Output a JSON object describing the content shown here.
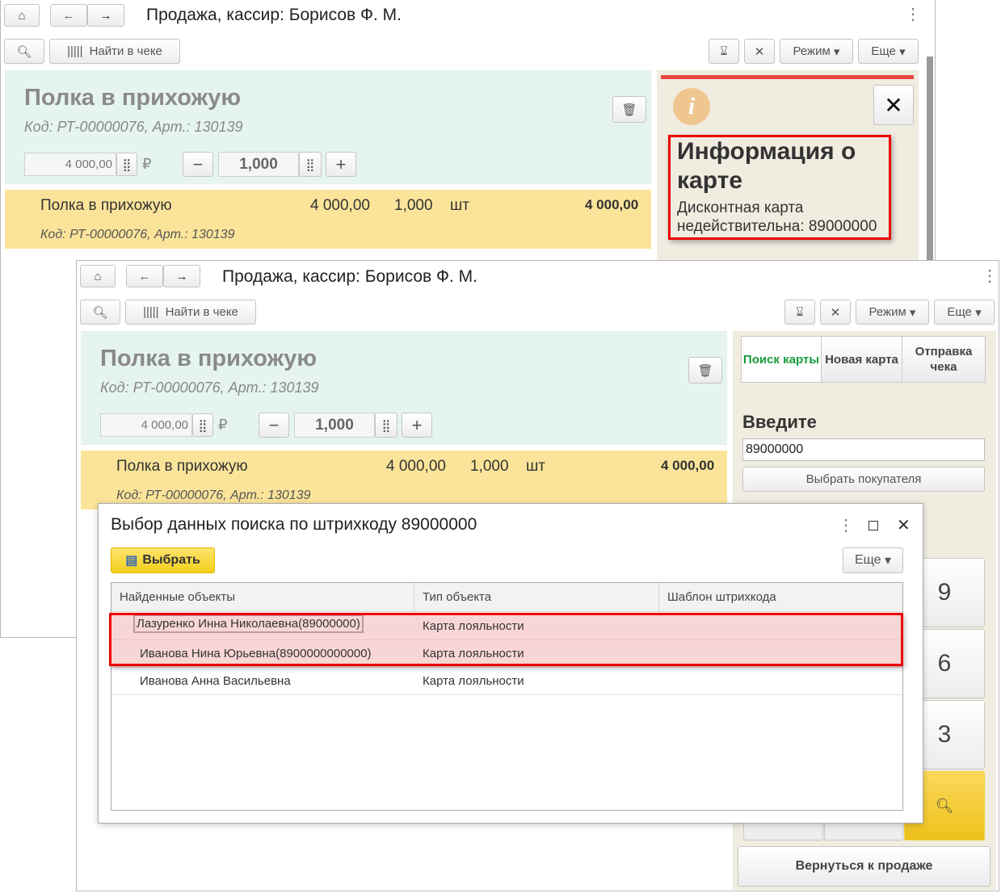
{
  "window": {
    "title": "Продажа, кассир: Борисов Ф. М.",
    "find_in_receipt": "Найти в чеке",
    "mode": "Режим",
    "more": "Еще"
  },
  "product": {
    "name": "Полка в прихожую",
    "code": "Код: РТ-00000076, Арт.: 130139",
    "price": "4 000,00",
    "currency": "₽",
    "qty": "1,000"
  },
  "line": {
    "name": "Полка в прихожую",
    "price": "4 000,00",
    "qty": "1,000",
    "unit": "шт",
    "sum": "4 000,00",
    "code": "Код: РТ-00000076, Арт.: 130139"
  },
  "info": {
    "heading": "Информация о карте",
    "message": "Дисконтная карта недействительна: 89000000"
  },
  "card_panel": {
    "tabs": [
      "Поиск карты",
      "Новая карта",
      "Отправка чека"
    ],
    "enter_label": "Введите",
    "input_value": "89000000",
    "choose_customer": "Выбрать покупателя",
    "keys": [
      "9",
      "6",
      "3"
    ],
    "back_to_sale": "Вернуться к продаже"
  },
  "dialog": {
    "title": "Выбор данных поиска по штрихкоду 89000000",
    "select": "Выбрать",
    "more": "Еще",
    "columns": [
      "Найденные объекты",
      "Тип объекта",
      "Шаблон штрихкода"
    ],
    "rows": [
      {
        "object": "Лазуренко Инна Николаевна(89000000)",
        "type": "Карта лояльности",
        "template": ""
      },
      {
        "object": "Иванова Нина Юрьевна(8900000000000)",
        "type": "Карта лояльности",
        "template": ""
      },
      {
        "object": "Иванова Анна Васильевна",
        "type": "Карта лояльности",
        "template": ""
      }
    ]
  }
}
